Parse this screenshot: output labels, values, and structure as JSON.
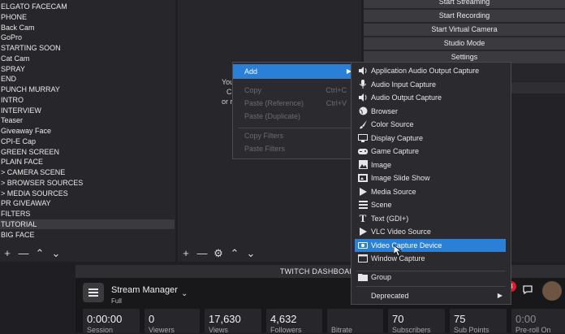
{
  "scenes": {
    "items": [
      "ELGATO FACECAM",
      "PHONE",
      "Back Cam",
      "GoPro",
      "STARTING SOON",
      "Cat Cam",
      "SPRAY",
      "END",
      "PUNCH MURRAY",
      "INTRO",
      "INTERVIEW",
      "Teaser",
      "Giveaway Face",
      "CPI-E Cap",
      "GREEN SCREEN",
      "PLAIN FACE",
      "> CAMERA SCENE",
      "> BROWSER SOURCES",
      "> MEDIA SOURCES",
      "PR GIVEAWAY",
      "FILTERS",
      "TUTORIAL",
      "BIG FACE"
    ],
    "selected": "TUTORIAL",
    "toolbar": {
      "add": "+",
      "remove": "—",
      "up": "⌃",
      "down": "⌄"
    }
  },
  "sources": {
    "hint_lines": [
      "You",
      "C",
      "or r"
    ],
    "toolbar": {
      "add": "+",
      "remove": "—",
      "settings": "⚙",
      "up": "⌃",
      "down": "⌄"
    }
  },
  "controls": {
    "buttons": [
      "Start Streaming",
      "Start Recording",
      "Start Virtual Camera",
      "Studio Mode",
      "Settings"
    ]
  },
  "context_menu": {
    "add": "Add",
    "add_arrow": "▶",
    "copy": "Copy",
    "copy_shortcut": "Ctrl+C",
    "paste_ref": "Paste (Reference)",
    "paste_ref_shortcut": "Ctrl+V",
    "paste_dup": "Paste (Duplicate)",
    "copy_filters": "Copy Filters",
    "paste_filters": "Paste Filters"
  },
  "add_menu": {
    "items": [
      {
        "label": "Application Audio Output Capture",
        "icon": "speaker-icon"
      },
      {
        "label": "Audio Input Capture",
        "icon": "microphone-icon"
      },
      {
        "label": "Audio Output Capture",
        "icon": "speaker-icon"
      },
      {
        "label": "Browser",
        "icon": "globe-icon"
      },
      {
        "label": "Color Source",
        "icon": "brush-icon"
      },
      {
        "label": "Display Capture",
        "icon": "monitor-icon"
      },
      {
        "label": "Game Capture",
        "icon": "gamepad-icon"
      },
      {
        "label": "Image",
        "icon": "image-icon"
      },
      {
        "label": "Image Slide Show",
        "icon": "slideshow-icon"
      },
      {
        "label": "Media Source",
        "icon": "play-icon"
      },
      {
        "label": "Scene",
        "icon": "list-icon"
      },
      {
        "label": "Text (GDI+)",
        "icon": "text-icon"
      },
      {
        "label": "VLC Video Source",
        "icon": "play-icon"
      },
      {
        "label": "Video Capture Device",
        "icon": "camera-icon"
      },
      {
        "label": "Window Capture",
        "icon": "window-icon"
      }
    ],
    "selected": "Video Capture Device",
    "group": "Group",
    "deprecated": "Deprecated",
    "deprecated_arrow": "▶"
  },
  "dashboard": {
    "title": "TWITCH DASHBOARD",
    "manager_title": "Stream Manager",
    "manager_sub": "Full",
    "notification_count": "3",
    "stats": [
      {
        "value": "0:00:00",
        "label": "Session"
      },
      {
        "value": "0",
        "label": "Viewers"
      },
      {
        "value": "17,630",
        "label": "Views"
      },
      {
        "value": "4,632",
        "label": "Followers"
      },
      {
        "value": "",
        "label": "Bitrate"
      },
      {
        "value": "70",
        "label": "Subscribers"
      },
      {
        "value": "75",
        "label": "Sub Points"
      },
      {
        "value": "0:00",
        "label": "Pre-roll On"
      }
    ]
  }
}
